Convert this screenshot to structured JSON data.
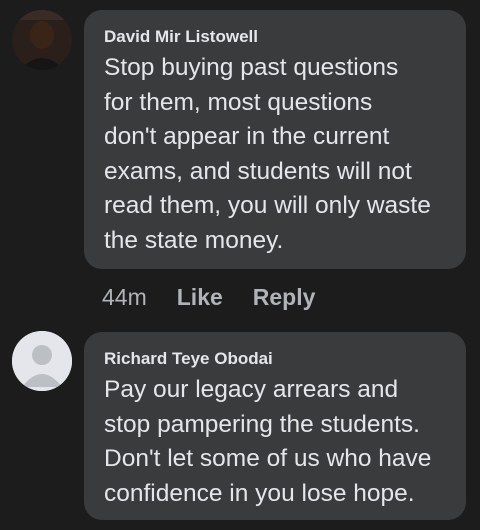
{
  "comments": [
    {
      "author": "David Mir Listowell",
      "text": "Stop buying past questions\nfor them, most questions\ndon't appear in the current\nexams, and students will not\nread them, you will only waste\nthe state money.",
      "time": "44m",
      "like_label": "Like",
      "reply_label": "Reply",
      "avatar": "profile-photo"
    },
    {
      "author": "Richard Teye Obodai",
      "text": "Pay our legacy arrears and\nstop pampering the students.\nDon't let some of us who have\nconfidence in you lose hope.",
      "avatar": "default-avatar-icon"
    }
  ]
}
